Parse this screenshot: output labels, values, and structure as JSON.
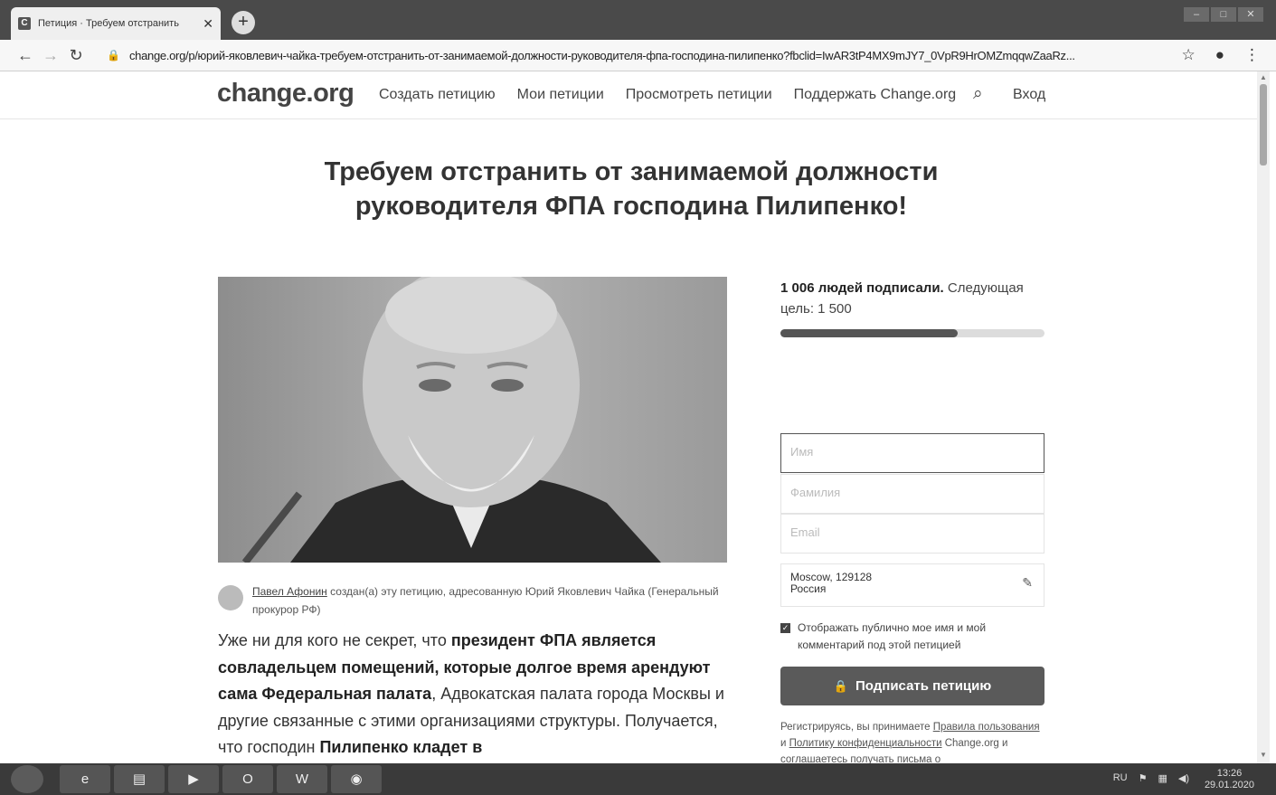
{
  "browser": {
    "tab_title": "Петиция · Требуем отстранить",
    "tab_favicon": "C",
    "url": "change.org/p/юрий-яковлевич-чайка-требуем-отстранить-от-занимаемой-должности-руководителя-фпа-господина-пилипенко?fbclid=IwAR3tP4MX9mJY7_0VpR9HrOMZmqqwZaaRz..."
  },
  "site": {
    "logo": "change.org",
    "nav": [
      "Создать петицию",
      "Мои петиции",
      "Просмотреть петиции",
      "Поддержать Change.org"
    ],
    "login": "Вход"
  },
  "petition": {
    "title_line1": "Требуем отстранить от занимаемой должности",
    "title_line2": "руководителя ФПА господина Пилипенко!",
    "author_name": "Павел Афонин",
    "author_text": "создан(а) эту петицию, адресованную Юрий Яковлевич Чайка (Генеральный прокурор РФ)",
    "body": [
      {
        "t": "Уже ни для кого не секрет, что ",
        "b": false
      },
      {
        "t": "президент ФПА является совладельцем помещений, которые долгое время арендуют сама Федеральная палата",
        "b": true
      },
      {
        "t": ", Адвокатская палата города Москвы и другие связанные с этими организациями структуры. Получается, что господин ",
        "b": false
      },
      {
        "t": "Пилипенко кладет в",
        "b": true
      }
    ]
  },
  "sidebar": {
    "signed_count": "1 006 людей подписали.",
    "next_goal": "Следующая цель: 1 500",
    "progress": 0.67,
    "first_name_placeholder": "Имя",
    "last_name_placeholder": "Фамилия",
    "email_placeholder": "Email",
    "location_line1": "Moscow, 129128",
    "location_line2": "Россия",
    "checkbox_label": "Отображать публично мое имя и мой комментарий под этой петицией",
    "sign_button": "Подписать петицию",
    "terms_prefix": "Регистрируясь, вы принимаете ",
    "terms_link1": "Правила пользования",
    "terms_mid": " и ",
    "terms_link2": "Политику конфиденциальности",
    "terms_suffix": " Change.org и соглашаетесь получать письма о"
  },
  "taskbar": {
    "lang": "RU",
    "time": "13:26",
    "date": "29.01.2020"
  }
}
